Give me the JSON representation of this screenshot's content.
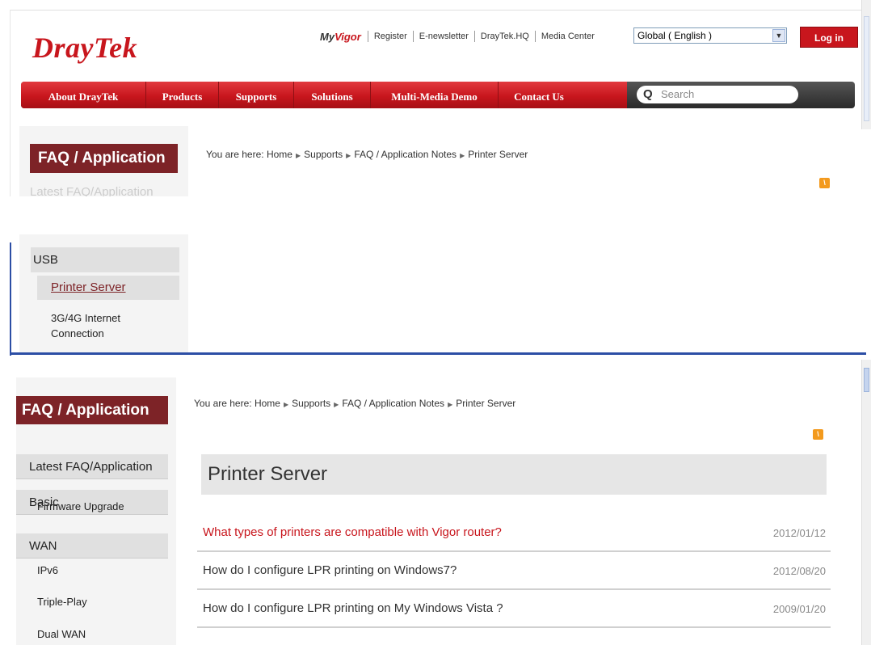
{
  "header": {
    "logo": "DrayTek",
    "myvigor_my": "My",
    "myvigor_vigor": "Vigor",
    "top_links": [
      "Register",
      "E-newsletter",
      "DrayTek.HQ",
      "Media Center"
    ],
    "region_select": "Global ( English )",
    "login_label": "Log in"
  },
  "nav": {
    "items": [
      "About DrayTek",
      "Products",
      "Supports",
      "Solutions",
      "Multi-Media Demo",
      "Contact Us"
    ],
    "search_placeholder": "Search"
  },
  "breadcrumb": {
    "prefix": "You are here:",
    "items": [
      "Home",
      "Supports",
      "FAQ / Application Notes",
      "Printer Server"
    ]
  },
  "sidebar": {
    "heading": "FAQ / Application",
    "latest": "Latest FAQ/Application",
    "sections": [
      {
        "label": "Basic",
        "subs": [
          "Firmware Upgrade"
        ]
      },
      {
        "label": "WAN",
        "subs": [
          "IPv6",
          "Triple-Play",
          "Dual WAN"
        ]
      },
      {
        "label": "USB",
        "subs": [
          "Printer Server",
          "3G/4G Internet Connection"
        ]
      }
    ],
    "g34_line1": "3G/4G Internet",
    "g34_line2": "Connection"
  },
  "main": {
    "title": "Printer Server",
    "faqs": [
      {
        "question": "What types of printers are compatible with Vigor router?",
        "date": "2012/01/12"
      },
      {
        "question": "How do I configure LPR printing on Windows7?",
        "date": "2012/08/20"
      },
      {
        "question": "How do I configure LPR printing on My Windows Vista ?",
        "date": "2009/01/20"
      }
    ]
  },
  "colors": {
    "brand_red": "#c8161d",
    "sidebar_heading": "#7d2327",
    "rss": "#f39a1e"
  }
}
